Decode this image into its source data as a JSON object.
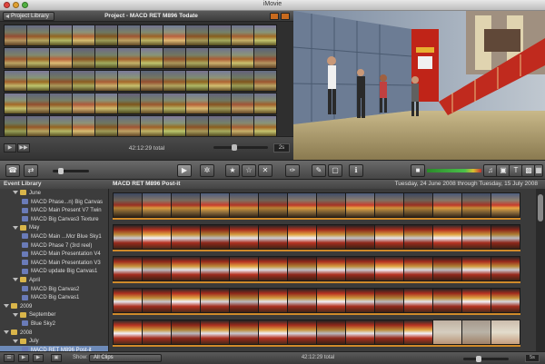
{
  "window": {
    "title": "iMovie"
  },
  "project": {
    "library_button": "Project Library",
    "title": "Project - MACD RET M896 Todate",
    "total": "42:12:29 total",
    "zoom": "2s",
    "footer_buttons": [
      "▶",
      "▶▶"
    ]
  },
  "toolbar": {
    "buttons": [
      "☎",
      "⇄",
      "▶",
      "✲",
      "★",
      "☆",
      "✕",
      "✑",
      "✎",
      "▢",
      "ℹ"
    ],
    "right_buttons": [
      "♫",
      "▣",
      "T",
      "▩",
      "▦"
    ]
  },
  "event_library": {
    "header": "Event Library",
    "items": [
      {
        "label": "June",
        "type": "month",
        "indent": 1
      },
      {
        "label": "MACD Phase...n) Big Canvas",
        "type": "clip",
        "indent": 2
      },
      {
        "label": "MACD Main Present V7 Twin",
        "type": "clip",
        "indent": 2
      },
      {
        "label": "MACD Big Canvas3 Texture",
        "type": "clip",
        "indent": 2
      },
      {
        "label": "May",
        "type": "month",
        "indent": 1
      },
      {
        "label": "MACD Main ...Mcr Blue Sky1",
        "type": "clip",
        "indent": 2
      },
      {
        "label": "MACD Phase 7 (3rd reel)",
        "type": "clip",
        "indent": 2
      },
      {
        "label": "MACD Main Presentation V4",
        "type": "clip",
        "indent": 2
      },
      {
        "label": "MACD Main Presentation V3",
        "type": "clip",
        "indent": 2
      },
      {
        "label": "MACD update Big Canvas1",
        "type": "clip",
        "indent": 2
      },
      {
        "label": "April",
        "type": "month",
        "indent": 1
      },
      {
        "label": "MACD Big Canvas2",
        "type": "clip",
        "indent": 2
      },
      {
        "label": "MACD Big Canvas1",
        "type": "clip",
        "indent": 2
      },
      {
        "label": "2009",
        "type": "year",
        "indent": 0
      },
      {
        "label": "September",
        "type": "month",
        "indent": 1
      },
      {
        "label": "Blue Sky2",
        "type": "clip",
        "indent": 2
      },
      {
        "label": "2008",
        "type": "year",
        "indent": 0
      },
      {
        "label": "July",
        "type": "month",
        "indent": 1
      },
      {
        "label": "MACD RET M896 Post-it",
        "type": "clip",
        "indent": 2,
        "selected": true
      }
    ]
  },
  "event_browser": {
    "title": "MACD RET M896 Post-it",
    "date_range": "Tuesday, 24 June 2008 through Tuesday, 15 July 2008"
  },
  "bottombar": {
    "show_label": "Show:",
    "show_value": "All Clips",
    "total": "42:12:29 total",
    "zoom": "5s"
  },
  "colors": {
    "selection": "#6d8ab8",
    "accent_orange": "#d08a2a",
    "folder": "#d9b54a"
  }
}
